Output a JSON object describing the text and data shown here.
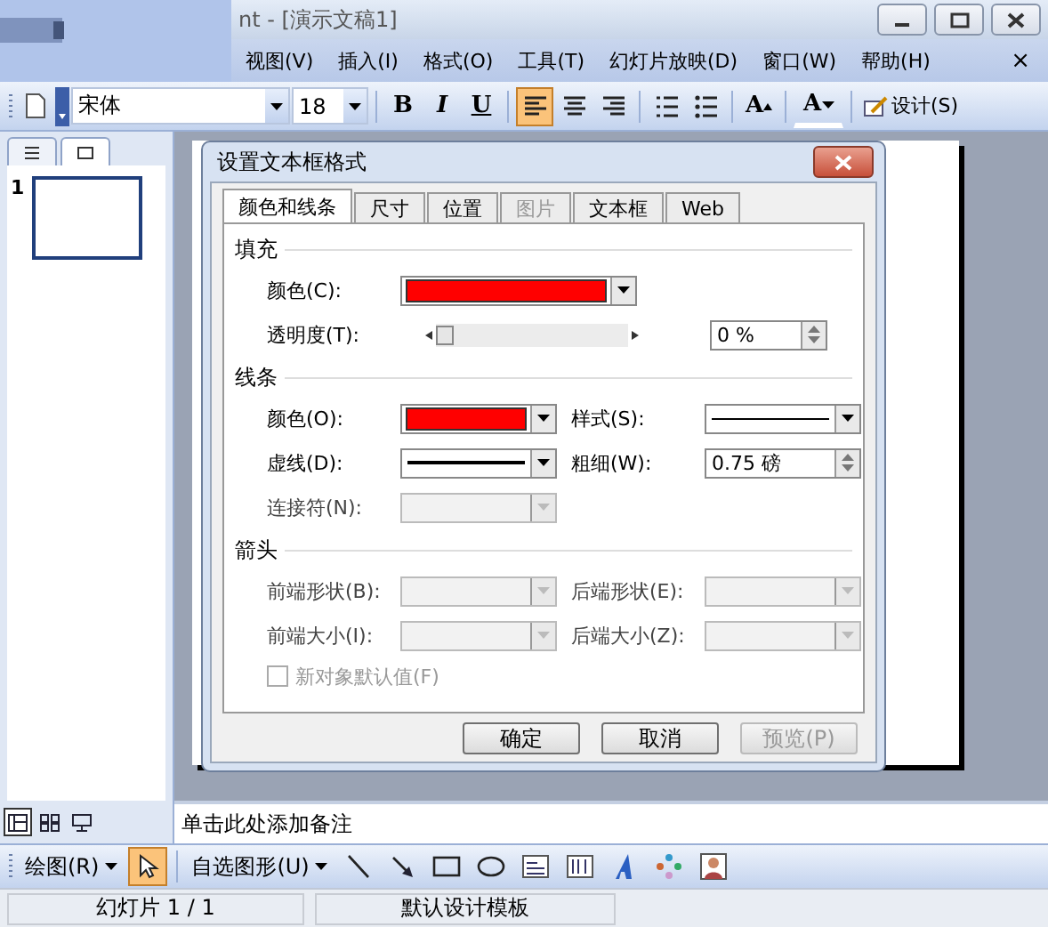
{
  "title_bar": {
    "title": "nt - [演示文稿1]"
  },
  "menu": {
    "items": [
      {
        "label": "视图(V)"
      },
      {
        "label": "插入(I)"
      },
      {
        "label": "格式(O)"
      },
      {
        "label": "工具(T)"
      },
      {
        "label": "幻灯片放映(D)"
      },
      {
        "label": "窗口(W)"
      },
      {
        "label": "帮助(H)"
      }
    ],
    "close": "×"
  },
  "toolbar": {
    "font": "宋体",
    "size": "18",
    "buttons": [
      {
        "kind": "bold",
        "label": "B",
        "selected": false
      },
      {
        "kind": "italic",
        "label": "I",
        "selected": false
      },
      {
        "kind": "underline",
        "label": "U",
        "selected": false
      },
      {
        "kind": "align-left",
        "selected": true
      },
      {
        "kind": "align-center",
        "selected": false
      },
      {
        "kind": "align-right",
        "selected": false
      },
      {
        "kind": "numbering",
        "selected": false
      },
      {
        "kind": "bullets",
        "selected": false
      },
      {
        "kind": "grow-font",
        "label": "A",
        "selected": false
      },
      {
        "kind": "font-color",
        "label": "A",
        "selected": false
      }
    ],
    "design": "设计(S)"
  },
  "slides_pane": {
    "tabs": [
      {
        "kind": "outline",
        "selected": false
      },
      {
        "kind": "slides",
        "selected": true
      }
    ],
    "slides": [
      {
        "number": "1",
        "selected": true
      }
    ]
  },
  "dialog": {
    "title": "设置文本框格式",
    "tabs": [
      {
        "label": "颜色和线条",
        "selected": true,
        "disabled": false
      },
      {
        "label": "尺寸",
        "selected": false,
        "disabled": false
      },
      {
        "label": "位置",
        "selected": false,
        "disabled": false
      },
      {
        "label": "图片",
        "selected": false,
        "disabled": true
      },
      {
        "label": "文本框",
        "selected": false,
        "disabled": false
      },
      {
        "label": "Web",
        "selected": false,
        "disabled": false
      }
    ],
    "sections": [
      {
        "title": "填充",
        "rows": [
          [
            {
              "kind": "color",
              "label": "颜色(C):",
              "color": "#ff0000"
            }
          ],
          [
            {
              "kind": "slider",
              "label": "透明度(T):",
              "level": 0,
              "value": "0 %"
            }
          ]
        ]
      },
      {
        "title": "线条",
        "rows": [
          [
            {
              "kind": "color",
              "label": "颜色(O):",
              "color": "#ff0000"
            },
            {
              "kind": "line-style",
              "label": "样式(S):"
            }
          ],
          [
            {
              "kind": "dash-style",
              "label": "虚线(D):"
            },
            {
              "kind": "spin",
              "label": "粗细(W):",
              "value": "0.75 磅"
            }
          ],
          [
            {
              "kind": "combo",
              "label": "连接符(N):",
              "disabled": true
            }
          ]
        ]
      },
      {
        "title": "箭头",
        "rows": [
          [
            {
              "kind": "combo",
              "label": "前端形状(B):",
              "disabled": true
            },
            {
              "kind": "combo",
              "label": "后端形状(E):",
              "disabled": true
            }
          ],
          [
            {
              "kind": "combo",
              "label": "前端大小(I):",
              "disabled": true
            },
            {
              "kind": "combo",
              "label": "后端大小(Z):",
              "disabled": true
            }
          ]
        ]
      }
    ],
    "default_checkbox": {
      "label": "新对象默认值(F)",
      "checked": false,
      "disabled": true
    },
    "buttons": [
      {
        "label": "确定",
        "disabled": false
      },
      {
        "label": "取消",
        "disabled": false
      },
      {
        "label": "预览(P)",
        "disabled": true
      }
    ]
  },
  "notes": {
    "placeholder": "单击此处添加备注"
  },
  "view_buttons": [
    {
      "kind": "normal",
      "selected": true
    },
    {
      "kind": "sorter",
      "selected": false
    },
    {
      "kind": "show",
      "selected": false
    }
  ],
  "drawing_toolbar": {
    "draw": "绘图(R)",
    "shapes": "自选图形(U)",
    "tools": [
      {
        "kind": "select",
        "selected": true
      },
      {
        "kind": "line",
        "selected": false
      },
      {
        "kind": "arrow",
        "selected": false
      },
      {
        "kind": "rectangle",
        "selected": false
      },
      {
        "kind": "oval",
        "selected": false
      },
      {
        "kind": "textbox",
        "selected": false
      },
      {
        "kind": "vertical-textbox",
        "selected": false
      },
      {
        "kind": "wordart",
        "selected": false
      },
      {
        "kind": "diagram",
        "selected": false
      },
      {
        "kind": "clipart",
        "selected": false
      }
    ]
  },
  "status_bar": {
    "fields": [
      "幻灯片 1 / 1",
      "默认设计模板"
    ]
  }
}
